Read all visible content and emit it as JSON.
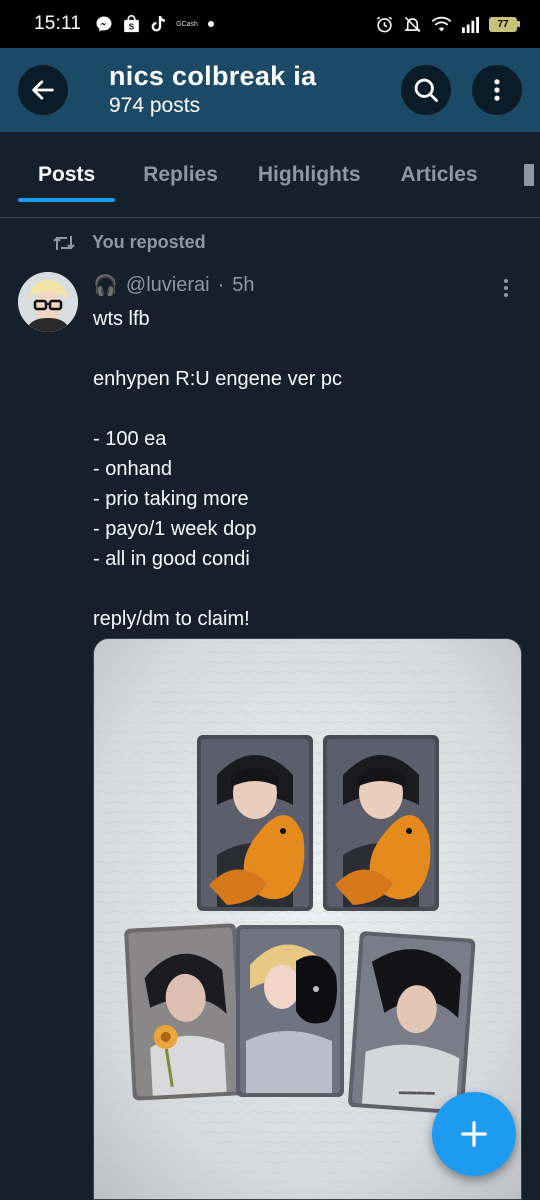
{
  "status_bar": {
    "time": "15:11",
    "gcash_label": "GCash",
    "battery": "77",
    "left_icons": [
      "messenger-icon",
      "shopee-icon",
      "tiktok-icon",
      "gcash-icon",
      "notification-dot-icon"
    ],
    "right_icons": [
      "alarm-icon",
      "mute-icon",
      "wifi-icon",
      "signal-icon",
      "battery-icon"
    ]
  },
  "header": {
    "name": "nics colbreak ia",
    "posts_count": "974 posts",
    "background_color": "#1b4a66"
  },
  "tabs": [
    {
      "label": "Posts",
      "active": true
    },
    {
      "label": "Replies",
      "active": false
    },
    {
      "label": "Highlights",
      "active": false
    },
    {
      "label": "Articles",
      "active": false
    }
  ],
  "post": {
    "repost_label": "You reposted",
    "author_emoji": "🎧",
    "author_handle": "@luvierai",
    "separator": "·",
    "time_ago": "5h",
    "text_lines": [
      "wts lfb",
      "",
      "enhypen R:U engene ver pc",
      "",
      "- 100 ea",
      "- onhand",
      "- prio taking more",
      "- payo/1 week dop",
      "- all in good condi",
      "",
      "reply/dm to claim!"
    ]
  },
  "fab": {
    "icon": "plus-icon"
  },
  "colors": {
    "background": "#15202b",
    "accent": "#1d9bf0",
    "secondary_text": "#8b98a5",
    "divider": "#38444d"
  }
}
